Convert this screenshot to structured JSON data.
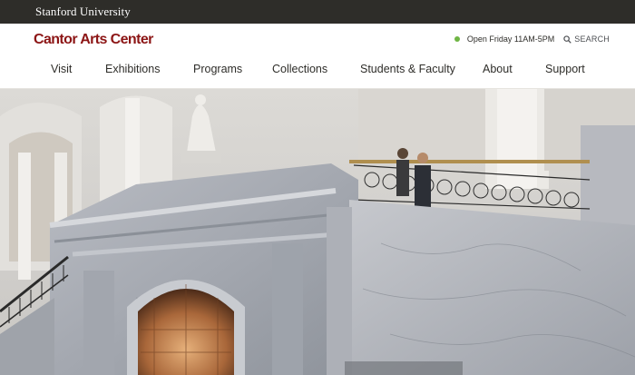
{
  "topbar": {
    "university": "Stanford University"
  },
  "header": {
    "brand": "Cantor Arts Center",
    "hours": "Open Friday 11AM-5PM",
    "search_label": "SEARCH"
  },
  "nav": {
    "items": [
      {
        "label": "Visit"
      },
      {
        "label": "Exhibitions"
      },
      {
        "label": "Programs"
      },
      {
        "label": "Collections"
      },
      {
        "label": "Students & Faculty"
      },
      {
        "label": "About"
      },
      {
        "label": "Support"
      }
    ]
  },
  "colors": {
    "topbar": "#2e2d29",
    "brand": "#8c1515",
    "status_open": "#6fb544"
  },
  "hero": {
    "icon": "museum-staircase-photo"
  }
}
